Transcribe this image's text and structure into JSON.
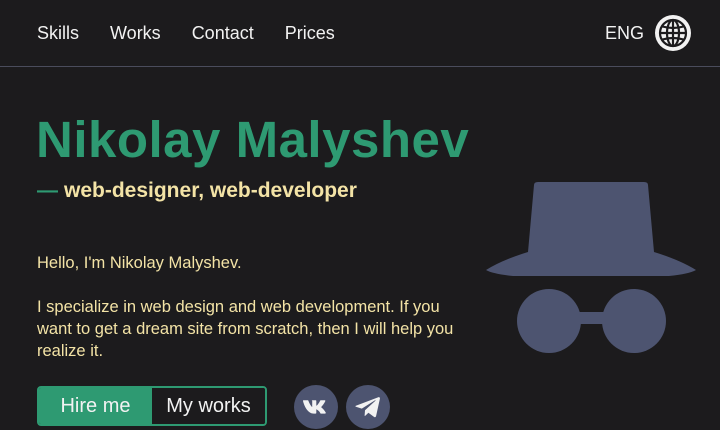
{
  "nav": {
    "items": [
      {
        "label": "Skills"
      },
      {
        "label": "Works"
      },
      {
        "label": "Contact"
      },
      {
        "label": "Prices"
      }
    ],
    "language": "ENG",
    "language_icon": "globe-icon"
  },
  "hero": {
    "name": "Nikolay Malyshev",
    "dash": "—",
    "role": "web-designer, web-developer",
    "greeting": "Hello, I'm Nikolay Malyshev.",
    "description": "I specialize in web design and web development. If you want to get a dream site from scratch, then I will help you realize it.",
    "hire_label": "Hire me",
    "works_label": "My works",
    "illustration_icon": "incognito-icon"
  },
  "social": [
    {
      "icon": "vk-icon"
    },
    {
      "icon": "telegram-icon"
    }
  ],
  "colors": {
    "background": "#1c1b1d",
    "accent": "#2e9a72",
    "text_highlight": "#f3e3a6",
    "icon_fill": "#4d5470"
  }
}
